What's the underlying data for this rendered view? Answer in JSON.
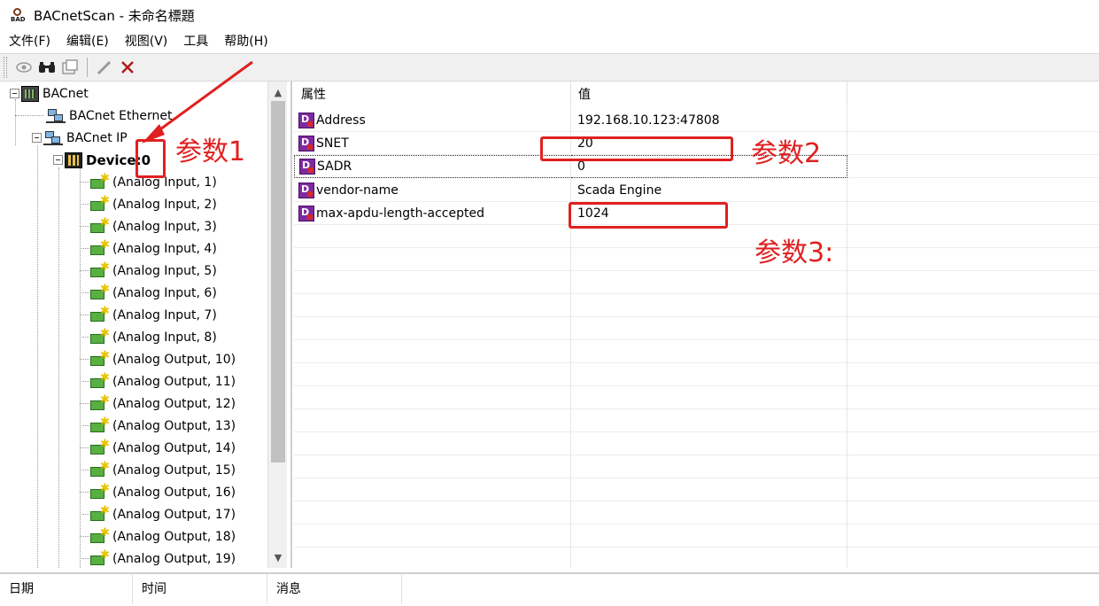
{
  "window": {
    "title": "BACnetScan - 未命名標題"
  },
  "menu": [
    "文件(F)",
    "编辑(E)",
    "视图(V)",
    "工具",
    "帮助(H)"
  ],
  "toolbar": {
    "icons": [
      "eye-icon",
      "binoculars-icon",
      "properties-icon",
      "pencil-icon",
      "delete-icon"
    ]
  },
  "tree": {
    "root": "BACnet",
    "ethernet": "BACnet Ethernet",
    "ip": "BACnet IP",
    "device": "Device:0",
    "objects": [
      "(Analog Input, 1)",
      "(Analog Input, 2)",
      "(Analog Input, 3)",
      "(Analog Input, 4)",
      "(Analog Input, 5)",
      "(Analog Input, 6)",
      "(Analog Input, 7)",
      "(Analog Input, 8)",
      "(Analog Output, 10)",
      "(Analog Output, 11)",
      "(Analog Output, 12)",
      "(Analog Output, 13)",
      "(Analog Output, 14)",
      "(Analog Output, 15)",
      "(Analog Output, 16)",
      "(Analog Output, 17)",
      "(Analog Output, 18)",
      "(Analog Output, 19)"
    ]
  },
  "grid": {
    "headers": {
      "property": "属性",
      "value": "值"
    },
    "rows": [
      {
        "name": "Address",
        "value": "192.168.10.123:47808"
      },
      {
        "name": "SNET",
        "value": "20"
      },
      {
        "name": "SADR",
        "value": "0"
      },
      {
        "name": "vendor-name",
        "value": "Scada Engine"
      },
      {
        "name": "max-apdu-length-accepted",
        "value": "1024"
      }
    ]
  },
  "annotations": {
    "label1": "参数1",
    "label2": "参数2",
    "label3": "参数3:",
    "color": "#e02020"
  },
  "log": {
    "date": "日期",
    "time": "时间",
    "message": "消息"
  }
}
